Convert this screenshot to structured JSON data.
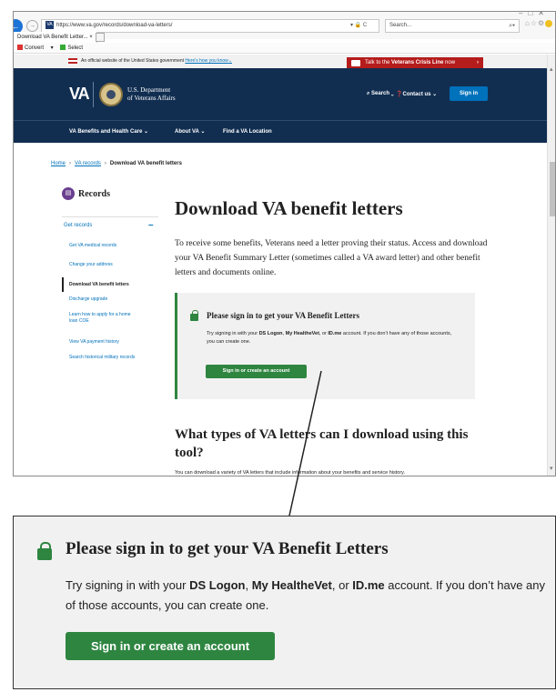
{
  "browser": {
    "url": "https://www.va.gov/records/download-va-letters/",
    "search_placeholder": "Search...",
    "tab_label": "Download VA Benefit Letter...",
    "cmd_convert": "Convert",
    "cmd_select": "Select"
  },
  "gov_banner": {
    "text": "An official website of the United States government",
    "link": "Here's how you know"
  },
  "crisis_line": {
    "prefix": "Talk to the ",
    "bold": "Veterans Crisis Line",
    "suffix": " now"
  },
  "header": {
    "logo": "VA",
    "dept_line1": "U.S. Department",
    "dept_line2": "of Veterans Affairs",
    "search": "Search",
    "contact": "Contact us",
    "sign_in": "Sign in"
  },
  "nav": {
    "items": [
      "VA Benefits and Health Care",
      "About VA",
      "Find a VA Location"
    ]
  },
  "breadcrumb": {
    "home": "Home",
    "records": "VA records",
    "current": "Download VA benefit letters"
  },
  "sidebar": {
    "title": "Records",
    "section": "Get records",
    "items": [
      "Get VA medical records",
      "Change your address",
      "Download VA benefit letters",
      "Discharge upgrade",
      "Learn how to apply for a home loan COE",
      "View VA payment history",
      "Search historical military records"
    ]
  },
  "main": {
    "title": "Download VA benefit letters",
    "lede": "To receive some benefits, Veterans need a letter proving their status. Access and download your VA Benefit Summary Letter (sometimes called a VA award letter) and other benefit letters and documents online.",
    "alert_title": "Please sign in to get your VA Benefit Letters",
    "alert_text_1": "Try signing in with your ",
    "alert_ds": "DS Logon",
    "alert_sep1": ", ",
    "alert_mhv": "My HealtheVet",
    "alert_sep2": ", or ",
    "alert_idme": "ID.me",
    "alert_text_2": " account. If you don’t have any of those accounts, you can create one.",
    "alert_button": "Sign in or create an account",
    "h2": "What types of VA letters can I download using this tool?",
    "intro": "You can download a variety of VA letters that include information about your benefits and service history."
  },
  "colors": {
    "va_navy": "#112e51",
    "link_blue": "#0071bb",
    "success_green": "#2e8540",
    "crisis_red": "#b51c1c"
  }
}
